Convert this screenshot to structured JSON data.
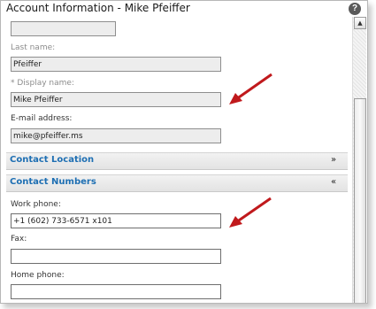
{
  "window": {
    "title": "Account Information - Mike Pfeiffer",
    "help_icon": "help-icon"
  },
  "form": {
    "top_field_value": "",
    "last_name": {
      "label": "Last name:",
      "value": "Pfeiffer"
    },
    "display_name": {
      "label": "* Display name:",
      "value": "Mike Pfeiffer"
    },
    "email": {
      "label": "E-mail address:",
      "value": "mike@pfeiffer.ms"
    },
    "sections": {
      "contact_location": {
        "label": "Contact Location",
        "state_icon": "expand-chevron-icon"
      },
      "contact_numbers": {
        "label": "Contact Numbers",
        "state_icon": "collapse-chevron-icon"
      }
    },
    "work_phone": {
      "label": "Work phone:",
      "value": "+1 (602) 733-6571 x101"
    },
    "fax": {
      "label": "Fax:",
      "value": ""
    },
    "home_phone": {
      "label": "Home phone:",
      "value": ""
    }
  },
  "annotations": {
    "arrow_color": "#c0191c"
  },
  "colors": {
    "section_text": "#1e6fb3",
    "readonly_field_bg": "#ededed"
  }
}
